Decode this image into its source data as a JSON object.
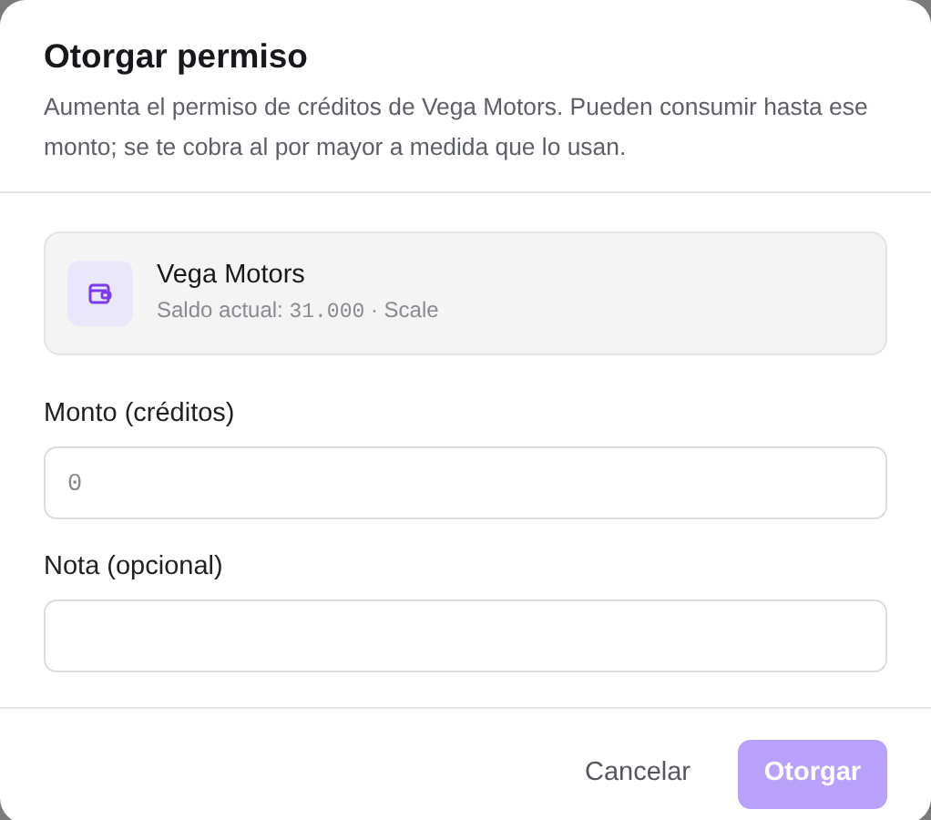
{
  "dialog": {
    "title": "Otorgar permiso",
    "description": "Aumenta el permiso de créditos de Vega Motors. Pueden consumir hasta ese monto; se te cobra al por mayor a medida que lo usan."
  },
  "account": {
    "name": "Vega Motors",
    "balance_prefix": "Saldo actual: ",
    "balance": "31.000",
    "suffix": " · Scale"
  },
  "fields": [
    {
      "label": "Monto (créditos)",
      "placeholder": "0"
    },
    {
      "label": "Nota (opcional)"
    }
  ],
  "buttons": [
    {
      "label": "Cancelar",
      "kind": "secondary"
    },
    {
      "label": "Otorgar",
      "kind": "primary",
      "disabled": true
    }
  ]
}
